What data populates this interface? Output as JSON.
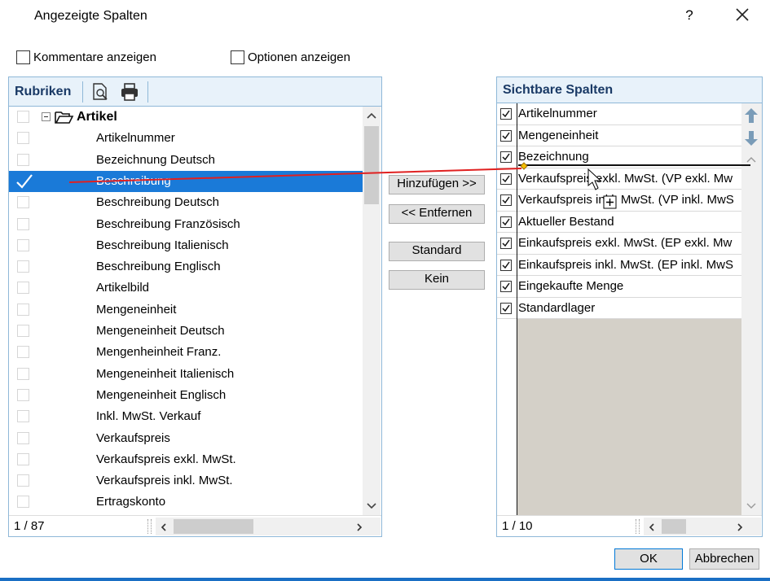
{
  "dialog": {
    "title": "Angezeigte Spalten",
    "help_label": "?",
    "close_icon": "close-icon"
  },
  "options": {
    "show_comments": {
      "label": "Kommentare anzeigen",
      "checked": false
    },
    "show_options": {
      "label": "Optionen anzeigen",
      "checked": false
    }
  },
  "left_panel": {
    "header": "Rubriken",
    "toolbar_icons": [
      "preview-icon",
      "print-icon"
    ],
    "group": {
      "label": "Artikel",
      "icon": "folder-open-icon",
      "expanded": true
    },
    "items": [
      {
        "label": "Artikelnummer",
        "selected": false
      },
      {
        "label": "Bezeichnung Deutsch",
        "selected": false
      },
      {
        "label": "Beschreibung",
        "selected": true
      },
      {
        "label": "Beschreibung Deutsch",
        "selected": false
      },
      {
        "label": "Beschreibung Französisch",
        "selected": false
      },
      {
        "label": "Beschreibung Italienisch",
        "selected": false
      },
      {
        "label": "Beschreibung Englisch",
        "selected": false
      },
      {
        "label": "Artikelbild",
        "selected": false
      },
      {
        "label": "Mengeneinheit",
        "selected": false
      },
      {
        "label": "Mengeneinheit Deutsch",
        "selected": false
      },
      {
        "label": "Mengenheinheit Franz.",
        "selected": false
      },
      {
        "label": "Mengeneinheit Italienisch",
        "selected": false
      },
      {
        "label": "Mengeneinheit Englisch",
        "selected": false
      },
      {
        "label": "Inkl. MwSt. Verkauf",
        "selected": false
      },
      {
        "label": "Verkaufspreis",
        "selected": false
      },
      {
        "label": "Verkaufspreis exkl. MwSt.",
        "selected": false
      },
      {
        "label": "Verkaufspreis inkl. MwSt.",
        "selected": false
      },
      {
        "label": "Ertragskonto",
        "selected": false
      }
    ],
    "status": "1 / 87"
  },
  "buttons": {
    "add": "Hinzufügen >>",
    "remove": "<< Entfernen",
    "standard": "Standard",
    "none": "Kein",
    "ok": "OK",
    "cancel": "Abbrechen"
  },
  "right_panel": {
    "header": "Sichtbare Spalten",
    "items": [
      {
        "label": "Artikelnummer",
        "checked": true
      },
      {
        "label": "Mengeneinheit",
        "checked": true
      },
      {
        "label": "Bezeichnung",
        "checked": true
      },
      {
        "label": "Verkaufspreis exkl. MwSt. (VP exkl. Mw",
        "checked": true
      },
      {
        "label": "Verkaufspreis inkl. MwSt. (VP inkl. MwS",
        "checked": true
      },
      {
        "label": "Aktueller Bestand",
        "checked": true
      },
      {
        "label": "Einkaufspreis exkl. MwSt. (EP exkl. Mw",
        "checked": true
      },
      {
        "label": "Einkaufspreis inkl. MwSt. (EP inkl. MwS",
        "checked": true
      },
      {
        "label": "Eingekaufte Menge",
        "checked": true
      },
      {
        "label": "Standardlager",
        "checked": true
      }
    ],
    "move_icons": [
      "arrow-up-icon",
      "arrow-down-icon"
    ],
    "status": "1 / 10"
  },
  "colors": {
    "selection": "#1a7ad8",
    "panel_border": "#8fb8d8",
    "header_text": "#1a3a66",
    "drag_line": "#e02020"
  }
}
